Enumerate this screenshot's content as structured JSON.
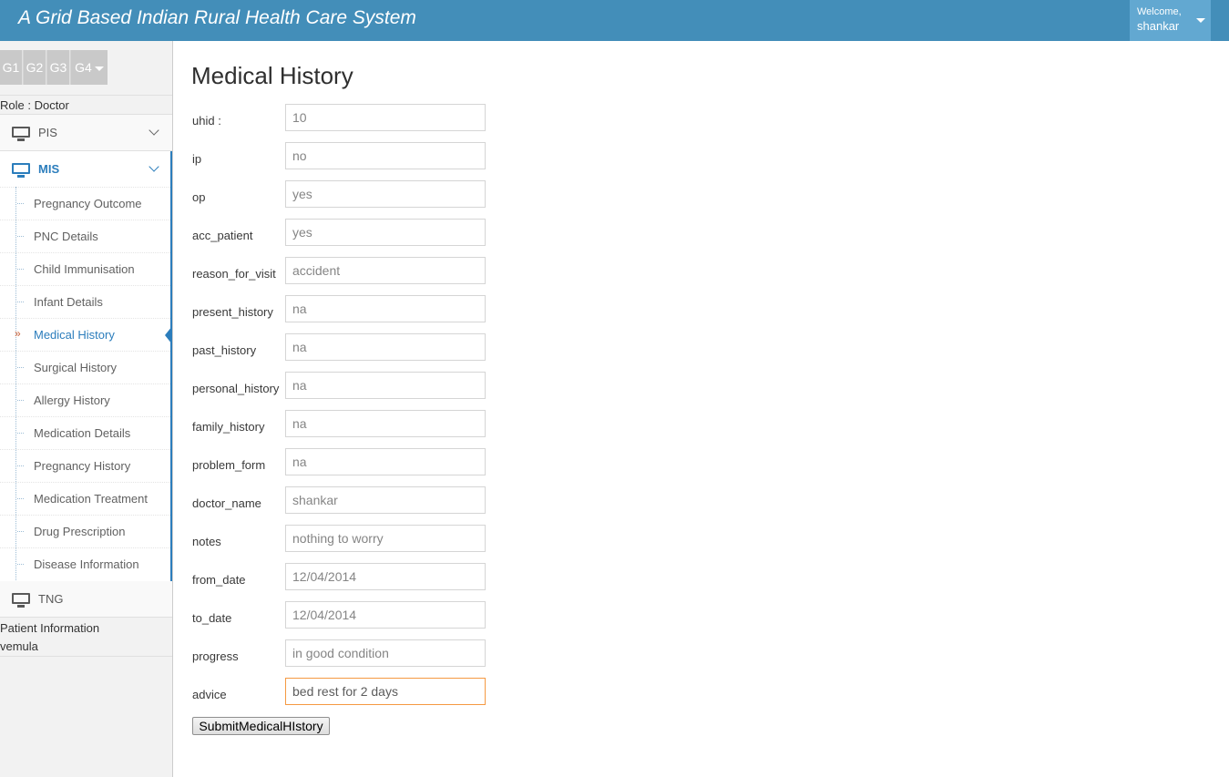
{
  "header": {
    "title": "A Grid Based Indian Rural Health Care System",
    "welcome": "Welcome,",
    "username": "shankar"
  },
  "sidebar": {
    "shortcuts": [
      "G1",
      "G2",
      "G3",
      "G4"
    ],
    "role": "Role : Doctor",
    "menus": [
      {
        "label": "PIS",
        "icon": "monitor-icon"
      },
      {
        "label": "MIS",
        "icon": "monitor-icon"
      },
      {
        "label": "TNG",
        "icon": "monitor-icon"
      }
    ],
    "submenu": [
      "Pregnancy Outcome",
      "PNC Details",
      "Child Immunisation",
      "Infant Details",
      "Medical History",
      "Surgical History",
      "Allergy History",
      "Medication Details",
      "Pregnancy History",
      "Medication Treatment",
      "Drug Prescription",
      "Disease Information"
    ],
    "active_item": "Medical History",
    "patient_info_label": "Patient Information",
    "patient_name": "vemula"
  },
  "page": {
    "title": "Medical History",
    "fields": [
      {
        "label": "uhid :",
        "value": "10"
      },
      {
        "label": "ip",
        "value": "no"
      },
      {
        "label": "op",
        "value": "yes"
      },
      {
        "label": "acc_patient",
        "value": "yes"
      },
      {
        "label": "reason_for_visit",
        "value": "accident"
      },
      {
        "label": "present_history",
        "value": "na"
      },
      {
        "label": "past_history",
        "value": "na"
      },
      {
        "label": "personal_history",
        "value": "na"
      },
      {
        "label": "family_history",
        "value": "na"
      },
      {
        "label": "problem_form",
        "value": "na"
      },
      {
        "label": "doctor_name",
        "value": "shankar"
      },
      {
        "label": "notes",
        "value": "nothing to worry"
      },
      {
        "label": "from_date",
        "value": "12/04/2014"
      },
      {
        "label": "to_date",
        "value": "12/04/2014"
      },
      {
        "label": "progress",
        "value": "in good condition"
      },
      {
        "label": "advice",
        "value": "bed rest for 2 days"
      }
    ],
    "submit_label": "SubmitMedicalHIstory"
  },
  "colors": {
    "header_bg": "#438eb9",
    "user_menu_bg": "#62a8d1",
    "accent": "#2b7dbc",
    "focus_border": "#f59942"
  }
}
